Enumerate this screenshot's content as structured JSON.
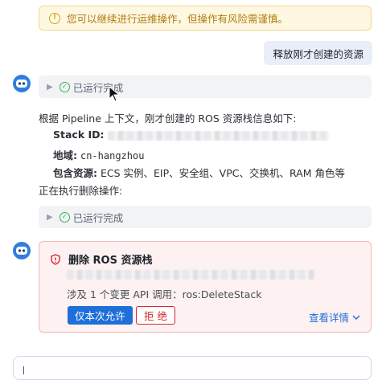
{
  "warning": {
    "text": "您可以继续进行运维操作，但操作有风险需谨慎。",
    "icon": "exclamation-circle-icon"
  },
  "user_message": {
    "text": "释放刚才创建的资源"
  },
  "run_status_1": {
    "label": "已运行完成"
  },
  "assistant": {
    "intro": "根据 Pipeline 上下文，刚才创建的 ROS 资源栈信息如下:",
    "stack_id_label": "Stack ID:",
    "region_label": "地域:",
    "region_value": "cn-hangzhou",
    "resources_label": "包含资源:",
    "resources_value": "ECS 实例、EIP、安全组、VPC、交换机、RAM 角色等",
    "executing": "正在执行删除操作:"
  },
  "run_status_2": {
    "label": "已运行完成"
  },
  "approval": {
    "title": "删除 ROS 资源栈",
    "desc": "涉及 1 个变更 API 调用：ros:DeleteStack",
    "allow_label": "仅本次允许",
    "reject_label": "拒 绝",
    "details_label": "查看详情"
  },
  "colors": {
    "primary": "#1e6fd9",
    "danger": "#d4282c",
    "success": "#35b34a",
    "warning": "#d9a21b"
  }
}
